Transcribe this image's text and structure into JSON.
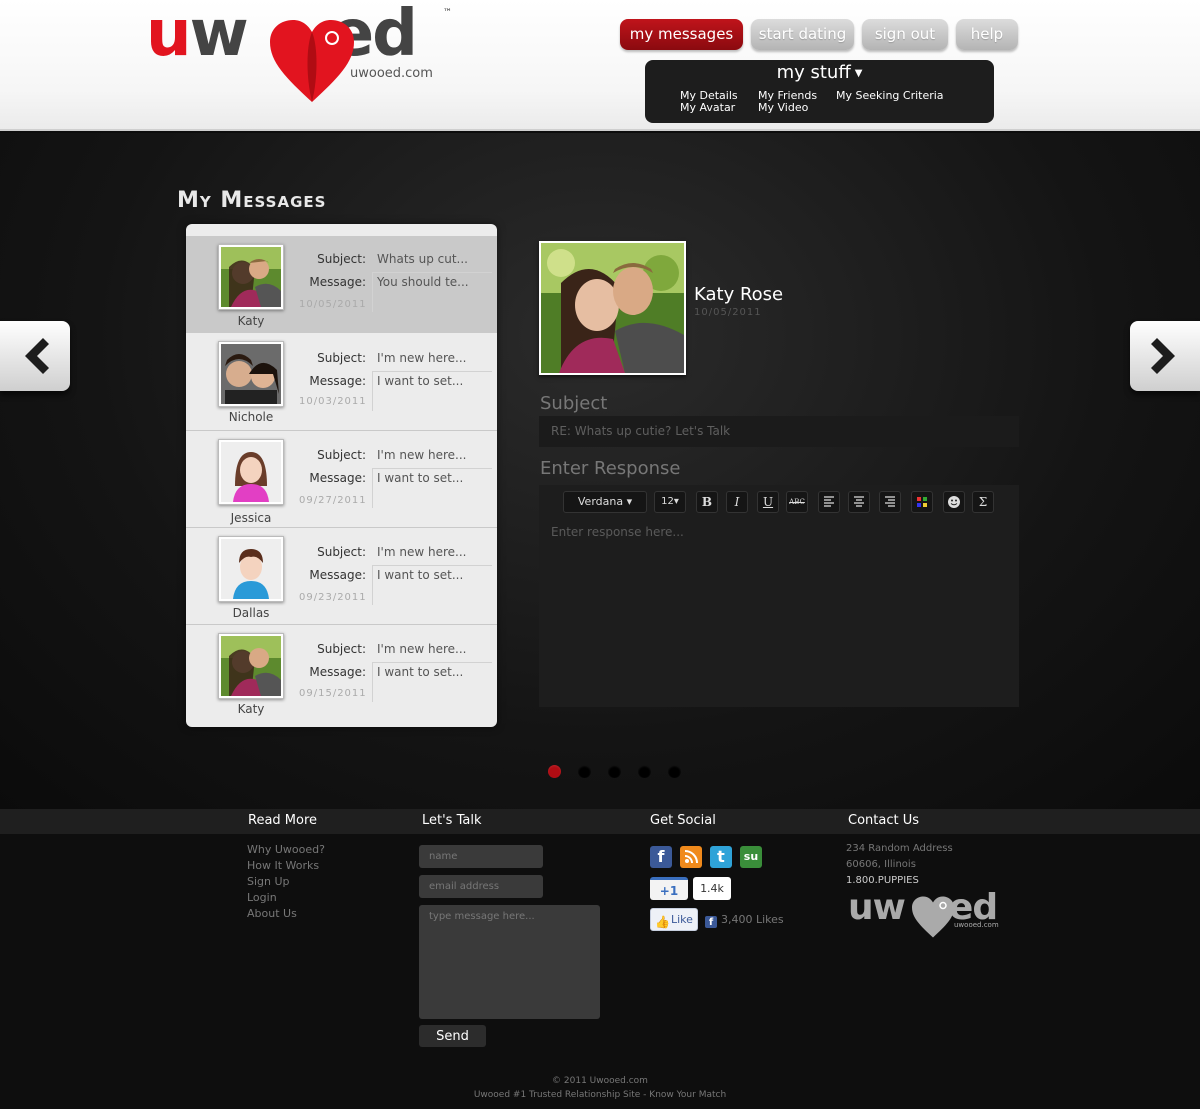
{
  "brand": {
    "logo_text_u": "u",
    "logo_text_w": "w",
    "logo_text_ed": "ed",
    "tm": "™",
    "sub": "uwooed.com"
  },
  "nav": {
    "my_messages": "my messages",
    "start_dating": "start dating",
    "sign_out": "sign out",
    "help": "help"
  },
  "mystuff": {
    "title": "my stuff",
    "links": [
      "My Details",
      "My Avatar",
      "My Friends",
      "My Video",
      "My Seeking Criteria"
    ]
  },
  "page": {
    "title": "My Messages",
    "subject_label": "Subject:",
    "message_label": "Message:"
  },
  "messages": [
    {
      "name": "Katy",
      "subject": "Whats up cut...",
      "message": "You should te...",
      "date": "10/05/2011",
      "avatar": "couple-photo"
    },
    {
      "name": "Nichole",
      "subject": "I'm new here...",
      "message": "I want to set...",
      "date": "10/03/2011",
      "avatar": "friends-photo"
    },
    {
      "name": "Jessica",
      "subject": "I'm new here...",
      "message": "I want to set...",
      "date": "09/27/2011",
      "avatar": "female-avatar"
    },
    {
      "name": "Dallas",
      "subject": "I'm new here...",
      "message": "I want to set...",
      "date": "09/23/2011",
      "avatar": "male-avatar"
    },
    {
      "name": "Katy",
      "subject": "I'm new here...",
      "message": "I want to set...",
      "date": "09/15/2011",
      "avatar": "couple-photo"
    }
  ],
  "detail": {
    "name": "Katy Rose",
    "date": "10/05/2011",
    "subject_heading": "Subject",
    "subject_value": "RE: Whats up cutie? Let's Talk",
    "response_heading": "Enter Response",
    "font_select": "Verdana",
    "size_select": "12",
    "response_placeholder": "Enter response here..."
  },
  "toolbar": {
    "bold": "B",
    "italic": "I",
    "underline": "U",
    "strike": "ABC",
    "sigma": "Σ"
  },
  "pagination": {
    "count": 5,
    "active": 1
  },
  "footer": {
    "read_more": {
      "heading": "Read More",
      "links": [
        "Why Uwooed?",
        "How It Works",
        "Sign Up",
        "Login",
        "About Us"
      ]
    },
    "lets_talk": {
      "heading": "Let's Talk",
      "name_placeholder": "name",
      "email_placeholder": "email address",
      "message_placeholder": "type message here...",
      "send": "Send"
    },
    "social": {
      "heading": "Get Social",
      "gplus_label": "+1",
      "gplus_count": "1.4k",
      "like_label": "Like",
      "likes_count": "3,400 Likes",
      "icons": [
        "facebook-icon",
        "rss-icon",
        "twitter-icon",
        "stumbleupon-icon"
      ]
    },
    "contact": {
      "heading": "Contact Us",
      "address1": "234 Random Address",
      "address2": "60606, Illinois",
      "phone": "1.800.PUPPIES"
    },
    "copyright": "© 2011 Uwooed.com",
    "tagline": "Uwooed #1 Trusted Relationship Site - Know Your Match"
  },
  "colors": {
    "accent": "#b00c13",
    "brand_red": "#e2141f",
    "footer_bg": "#0e0e0e"
  }
}
